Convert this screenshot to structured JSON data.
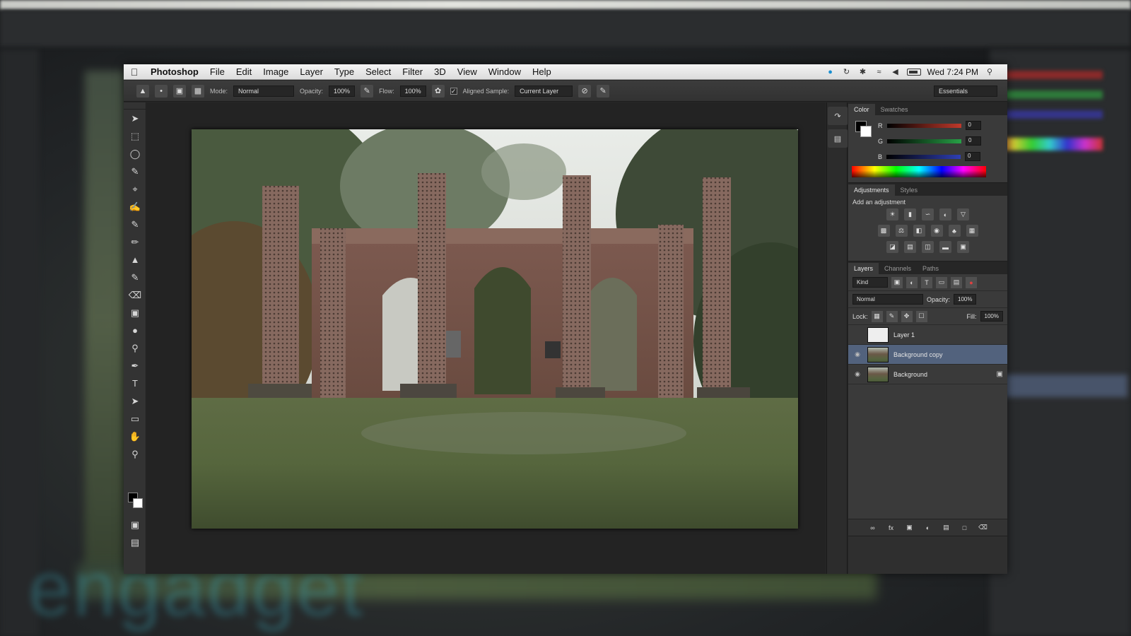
{
  "menubar": {
    "apple_icon": "apple-icon",
    "app_name": "Photoshop",
    "menus": [
      "File",
      "Edit",
      "Image",
      "Layer",
      "Type",
      "Select",
      "Filter",
      "3D",
      "View",
      "Window",
      "Help"
    ],
    "clock": "Wed 7:24 PM"
  },
  "options": {
    "mode_label": "Mode:",
    "mode_value": "Normal",
    "opacity_label": "Opacity:",
    "opacity_value": "100%",
    "flow_label": "Flow:",
    "flow_value": "100%",
    "aligned_label": "Aligned Sample:",
    "sample_value": "Current Layer",
    "workspace": "Essentials"
  },
  "color_panel": {
    "tabs": [
      "Color",
      "Swatches"
    ],
    "channels": [
      {
        "label": "R",
        "value": "0",
        "color": "#c0392b"
      },
      {
        "label": "G",
        "value": "0",
        "color": "#27a046"
      },
      {
        "label": "B",
        "value": "0",
        "color": "#2e3fb5"
      }
    ]
  },
  "adjustments_panel": {
    "tabs": [
      "Adjustments",
      "Styles"
    ],
    "title": "Add an adjustment"
  },
  "layers_panel": {
    "tabs": [
      "Layers",
      "Channels",
      "Paths"
    ],
    "kind_value": "Kind",
    "blend_value": "Normal",
    "opacity_label": "Opacity:",
    "opacity_value": "100%",
    "lock_label": "Lock:",
    "fill_label": "Fill:",
    "fill_value": "100%",
    "layers": [
      {
        "name": "Layer 1",
        "visible": false,
        "selected": false
      },
      {
        "name": "Background copy",
        "visible": true,
        "selected": true
      },
      {
        "name": "Background",
        "visible": true,
        "selected": false,
        "locked": true
      }
    ]
  },
  "watermark": "engadget",
  "colors": {
    "selected_layer": "#52627d",
    "panel_bg": "#3a3a3a",
    "menubar_bg": "#e8e8e8"
  }
}
